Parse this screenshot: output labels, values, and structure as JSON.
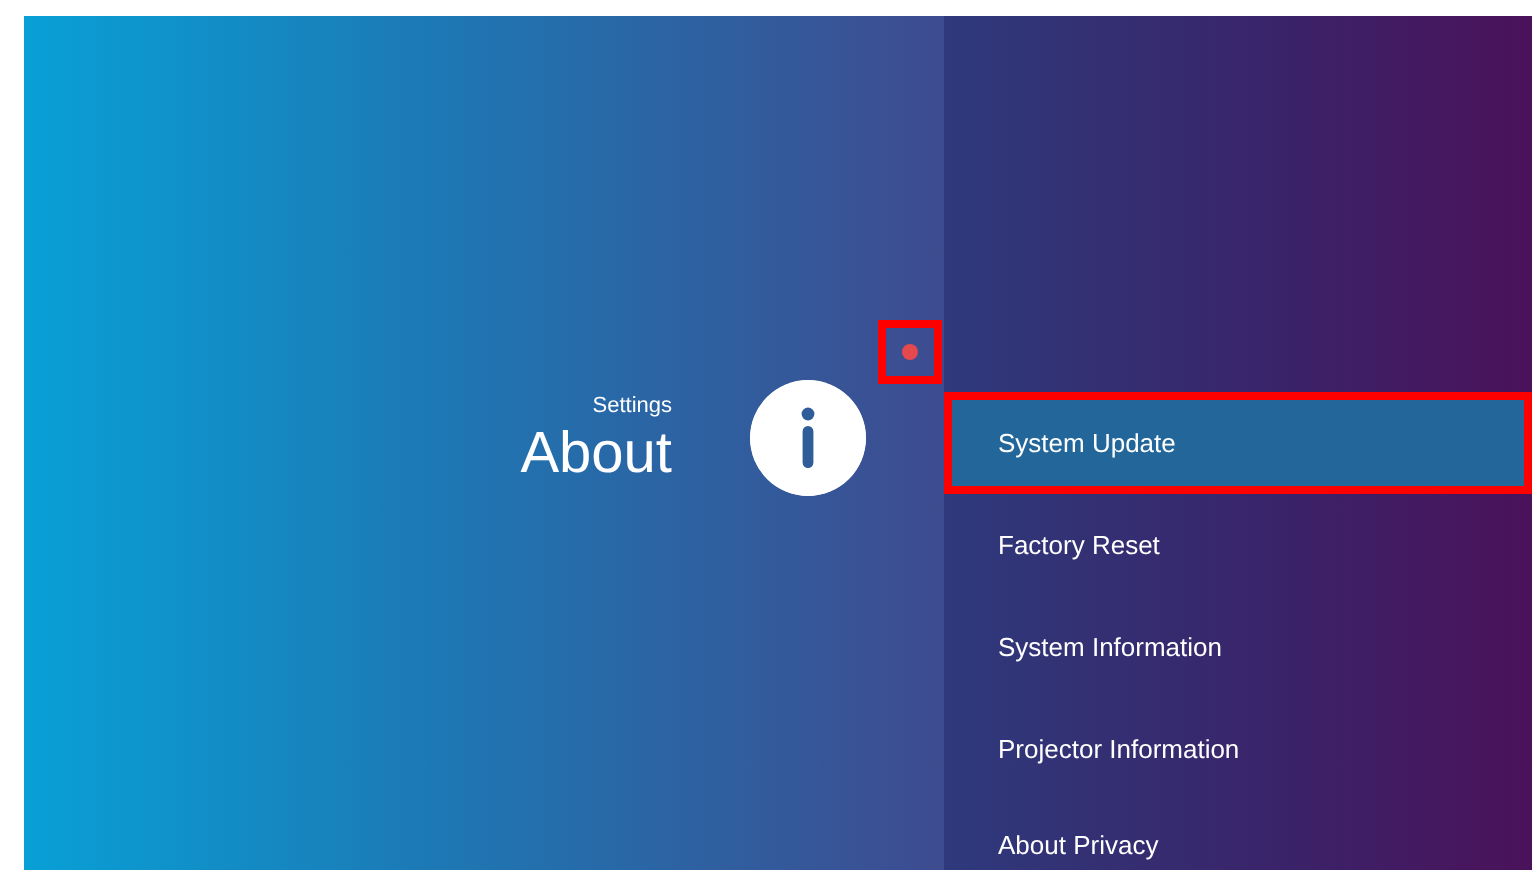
{
  "header": {
    "section": "Settings",
    "title": "About",
    "notification_dot": {
      "color": "#e5484d",
      "highlighted": true
    }
  },
  "menu": [
    {
      "label": "System Update",
      "selected": true,
      "highlighted": true
    },
    {
      "label": "Factory Reset",
      "selected": false,
      "highlighted": false
    },
    {
      "label": "System Information",
      "selected": false,
      "highlighted": false
    },
    {
      "label": "Projector Information",
      "selected": false,
      "highlighted": false
    },
    {
      "label": "About Privacy",
      "selected": false,
      "highlighted": false
    }
  ]
}
